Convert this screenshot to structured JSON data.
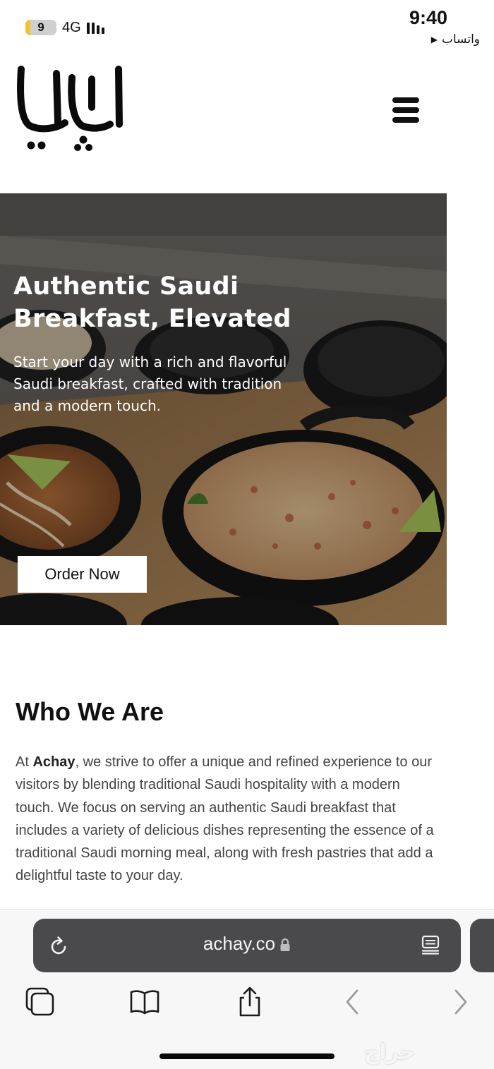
{
  "status_bar": {
    "battery_level": "9",
    "network": "4G",
    "time": "9:40",
    "back_app": "واتساب",
    "back_icon": "triangle-back-icon"
  },
  "site": {
    "logo_alt": "اجاي",
    "logo_icon": "achay-arabic-logo",
    "menu_icon": "hamburger-menu-icon"
  },
  "hero": {
    "title_line1": "Authentic Saudi",
    "title_line2": "Breakfast, Elevated",
    "subtitle_line1": "Start your day with a rich and flavorful",
    "subtitle_line2": "Saudi breakfast, crafted with tradition",
    "subtitle_line3": "and a modern touch.",
    "cta_label": "Order Now",
    "image_icon": "food-photo-placeholder"
  },
  "who_we_are": {
    "heading": "Who We Are",
    "lead": "At ",
    "brand": "Achay",
    "body": ", we strive to offer a unique and refined experience to our visitors by blending traditional Saudi hospitality with a modern touch. We focus on serving an authentic Saudi breakfast that includes a variety of delicious dishes representing the essence of a traditional Saudi morning meal, along with fresh pastries that add a delightful taste to your day."
  },
  "browser": {
    "url": "achay.co",
    "reload_icon": "reload-icon",
    "lock_icon": "lock-icon",
    "reader_icon": "reader-mode-icon",
    "toolbar": {
      "tabs_icon": "tabs-icon",
      "bookmarks_icon": "book-icon",
      "share_icon": "share-icon",
      "back_icon": "chevron-left-icon",
      "forward_icon": "chevron-right-icon"
    },
    "watermark": "حراج"
  }
}
